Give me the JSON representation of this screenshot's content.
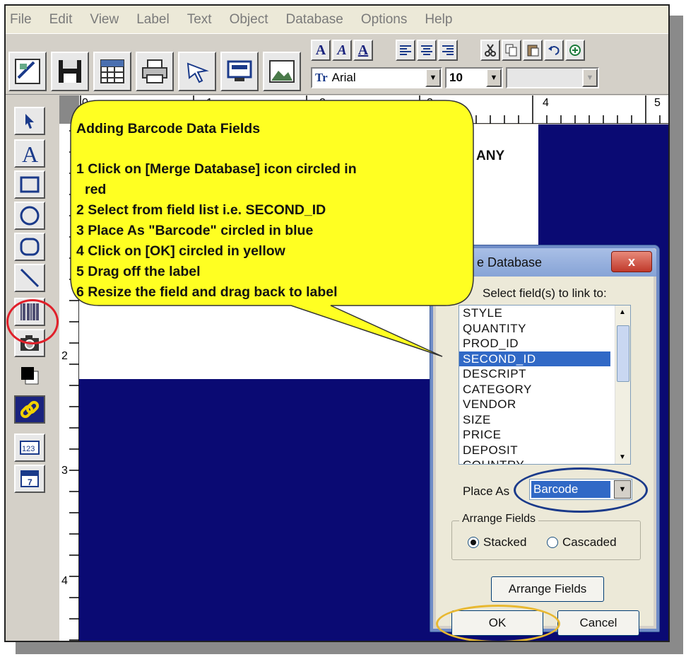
{
  "menu": [
    "File",
    "Edit",
    "View",
    "Label",
    "Text",
    "Object",
    "Database",
    "Options",
    "Help"
  ],
  "toolbar": {
    "font_name": "Arial",
    "font_size": "10",
    "format_buttons": [
      "A",
      "A",
      "A"
    ]
  },
  "ruler": {
    "top": [
      "0",
      "1",
      "2",
      "3",
      "4",
      "5"
    ],
    "left": [
      "2",
      "3",
      "4"
    ]
  },
  "canvas": {
    "label_text": "ANY"
  },
  "callout": {
    "title": "Adding Barcode Data Fields",
    "steps": [
      "1 Click on [Merge Database] icon circled in",
      "  red",
      "2 Select from field list   i.e. SECOND_ID",
      "3 Place As \"Barcode\" circled in blue",
      "4 Click on [OK] circled in yellow",
      "5 Drag off the label",
      "6 Resize the field and drag back to label"
    ]
  },
  "dialog": {
    "title": "e Database",
    "close_label": "x",
    "link_label": "Select field(s) to link to:",
    "fields": [
      "STYLE",
      "QUANTITY",
      "PROD_ID",
      "SECOND_ID",
      "DESCRIPT",
      "CATEGORY",
      "VENDOR",
      "SIZE",
      "PRICE",
      "DEPOSIT",
      "COUNTRY"
    ],
    "selected_field": "SECOND_ID",
    "place_as_label": "Place As",
    "place_as_value": "Barcode",
    "arrange_title": "Arrange Fields",
    "stacked_label": "Stacked",
    "cascaded_label": "Cascaded",
    "arrange_button": "Arrange Fields",
    "ok_label": "OK",
    "cancel_label": "Cancel"
  },
  "colors": {
    "canvas": "#0a0a73",
    "callout": "#ffff22",
    "selection": "#3169c6",
    "red_circle": "#e0202a",
    "blue_circle": "#1a3a8a",
    "yellow_circle": "#e8b830"
  }
}
